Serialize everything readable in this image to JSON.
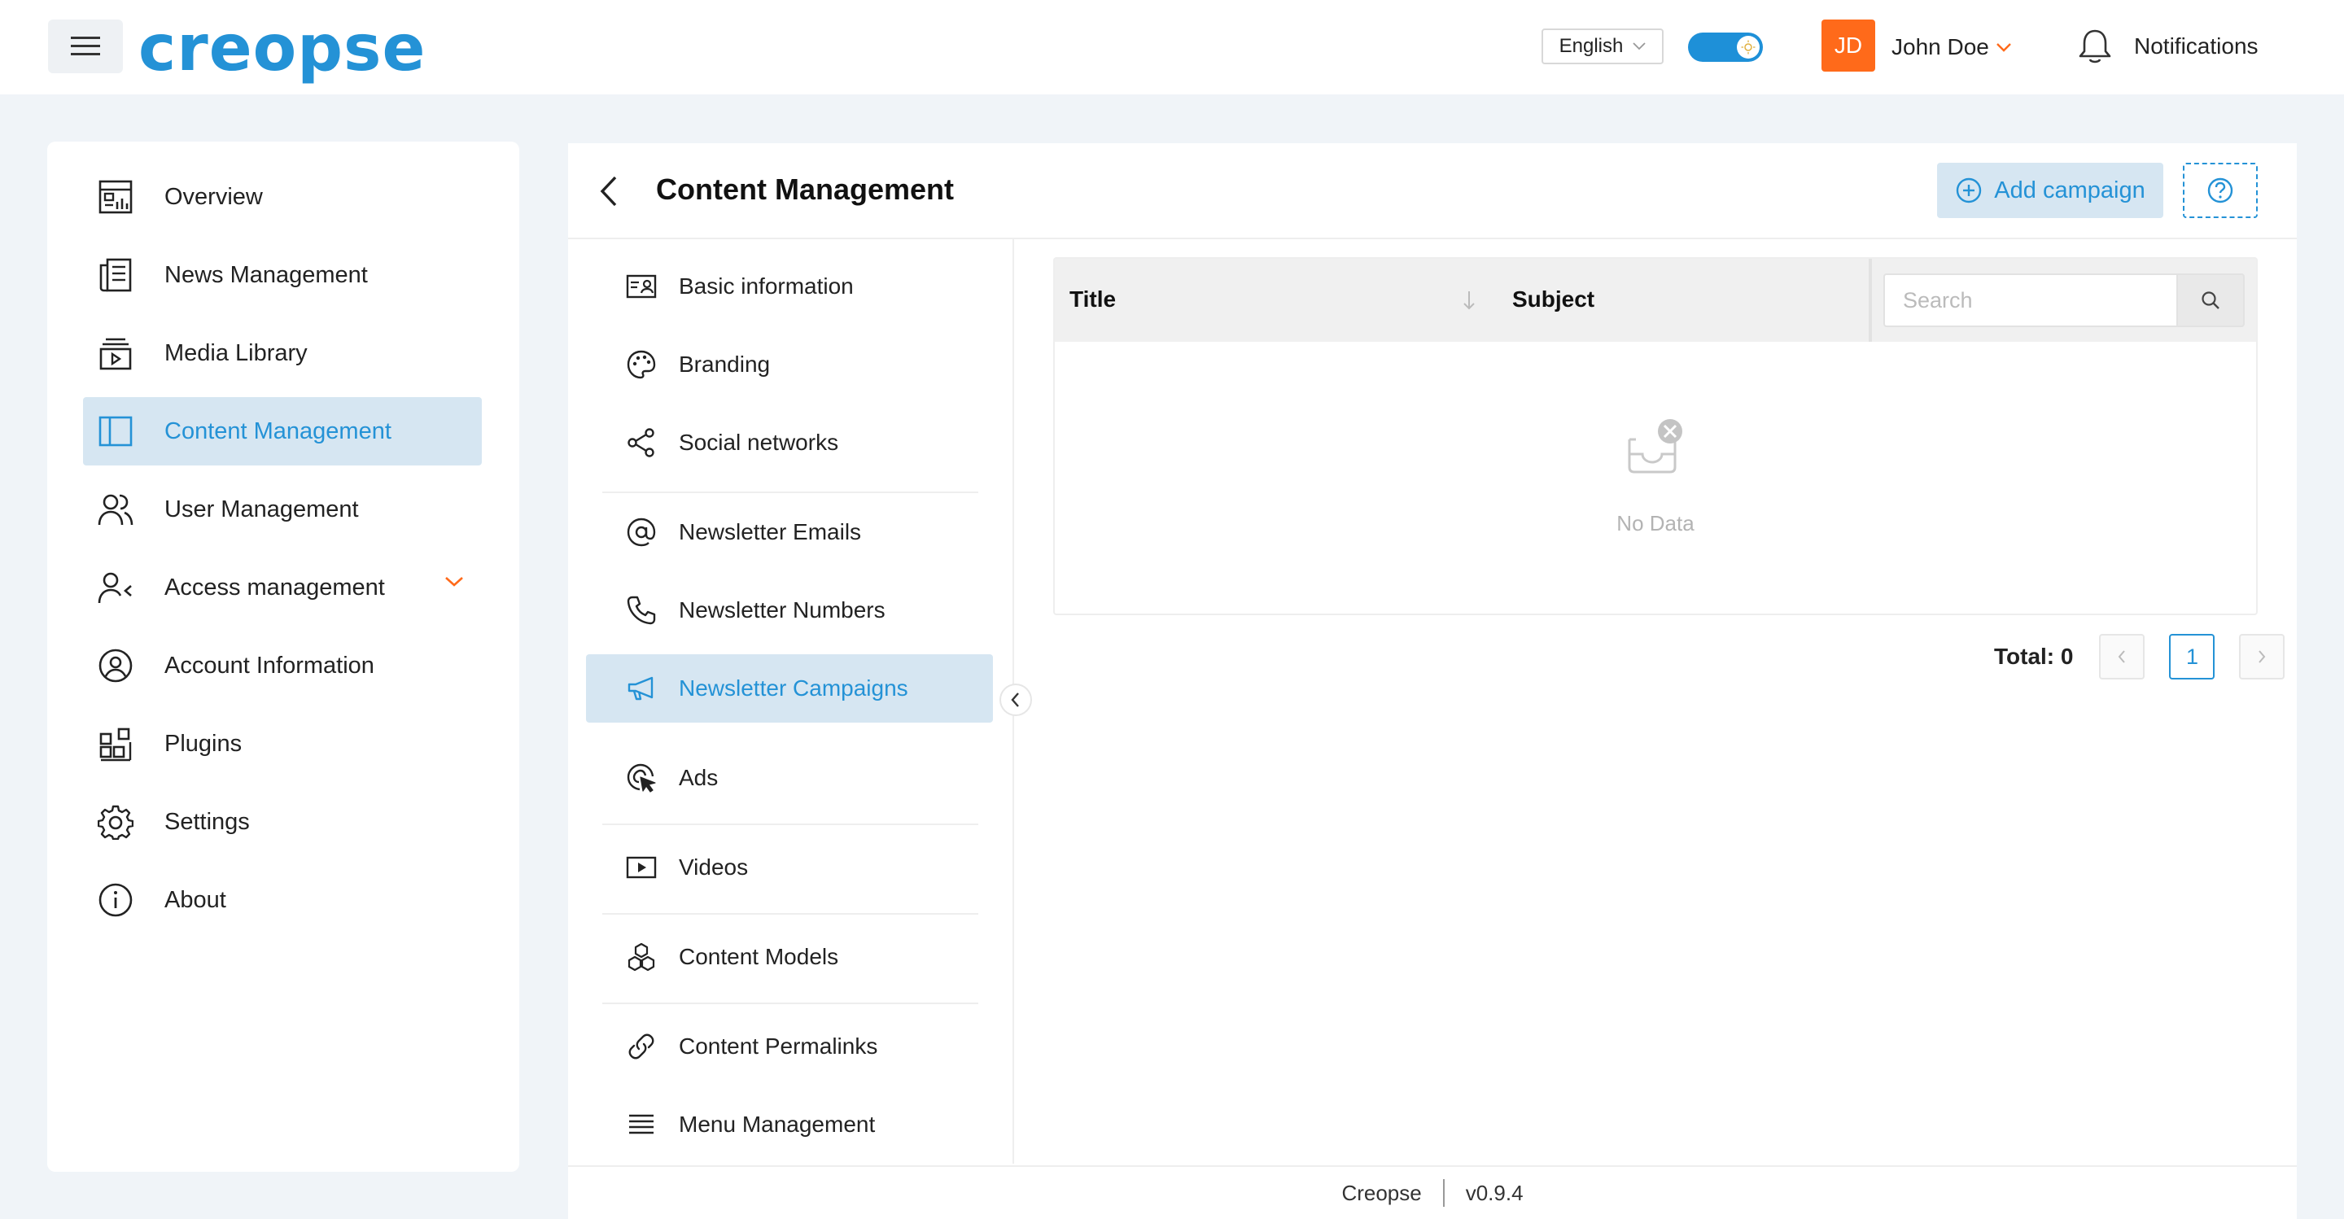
{
  "header": {
    "logo_text": "creopse",
    "language": "English",
    "user_initials": "JD",
    "user_name": "John Doe",
    "notifications_label": "Notifications"
  },
  "sidebar": {
    "items": [
      {
        "label": "Overview",
        "icon": "dashboard-icon"
      },
      {
        "label": "News Management",
        "icon": "newspaper-icon"
      },
      {
        "label": "Media Library",
        "icon": "media-icon"
      },
      {
        "label": "Content Management",
        "icon": "layout-icon",
        "active": true
      },
      {
        "label": "User Management",
        "icon": "users-icon"
      },
      {
        "label": "Access management",
        "icon": "user-access-icon",
        "expandable": true
      },
      {
        "label": "Account Information",
        "icon": "account-icon"
      },
      {
        "label": "Plugins",
        "icon": "plugins-icon"
      },
      {
        "label": "Settings",
        "icon": "gear-icon"
      },
      {
        "label": "About",
        "icon": "info-icon"
      }
    ]
  },
  "main": {
    "title": "Content Management",
    "add_button_label": "Add campaign",
    "sub_menu": [
      {
        "label": "Basic information",
        "icon": "id-card-icon"
      },
      {
        "label": "Branding",
        "icon": "palette-icon"
      },
      {
        "label": "Social networks",
        "icon": "share-icon"
      },
      {
        "label": "Newsletter Emails",
        "icon": "at-icon"
      },
      {
        "label": "Newsletter Numbers",
        "icon": "phone-icon"
      },
      {
        "label": "Newsletter Campaigns",
        "icon": "megaphone-icon",
        "active": true
      },
      {
        "label": "Ads",
        "icon": "target-cursor-icon"
      },
      {
        "label": "Videos",
        "icon": "video-icon"
      },
      {
        "label": "Content Models",
        "icon": "cubes-icon"
      },
      {
        "label": "Content Permalinks",
        "icon": "link-icon"
      },
      {
        "label": "Menu Management",
        "icon": "menu-lines-icon"
      }
    ],
    "table": {
      "columns": [
        "Title",
        "Subject"
      ],
      "search_placeholder": "Search",
      "empty_text": "No Data"
    },
    "pagination": {
      "total_label": "Total: 0",
      "current_page": "1"
    }
  },
  "footer": {
    "brand": "Creopse",
    "version": "v0.9.4"
  },
  "colors": {
    "accent": "#2492d6",
    "brand_orange": "#ff6a1a",
    "active_bg": "#d6e6f2"
  }
}
